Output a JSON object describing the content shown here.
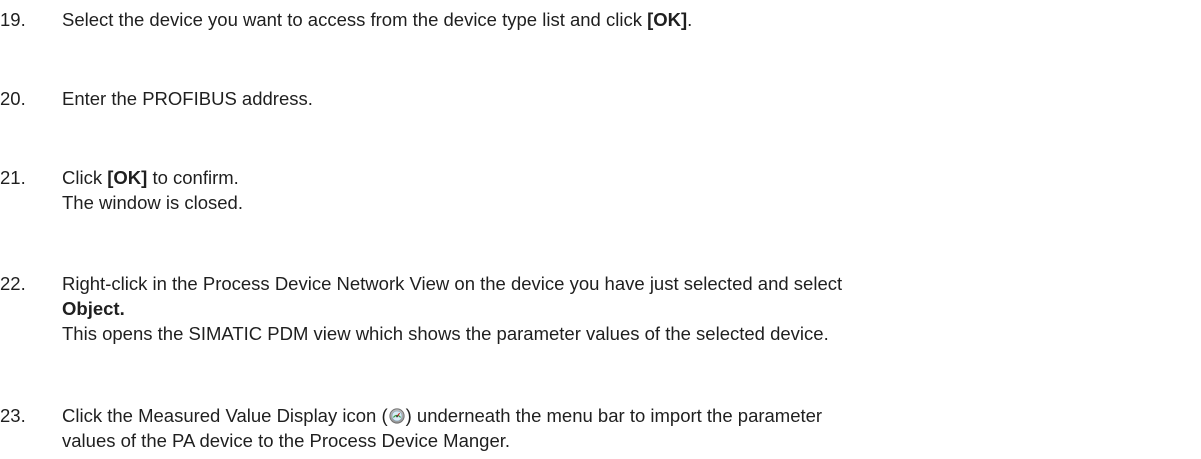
{
  "steps": [
    {
      "number": "19.",
      "line1_pre": "Select the device you want to access from the device type list and click ",
      "line1_bold": "[OK]",
      "line1_post": "."
    },
    {
      "number": "20.",
      "line1": "Enter the PROFIBUS address."
    },
    {
      "number": "21.",
      "line1_pre": "Click ",
      "line1_bold": "[OK]",
      "line1_post": " to confirm.",
      "line2": "The window is closed."
    },
    {
      "number": "22.",
      "line1": "Right-click in the Process Device Network View on the device you have just selected and select",
      "line2_bold": "Object.",
      "line3": "This opens the SIMATIC PDM view which shows the parameter values of the selected device."
    },
    {
      "number": "23.",
      "line1_pre": "Click the Measured Value Display icon (",
      "line1_icon": "measured-value-display-icon",
      "line1_post": ") underneath the menu bar to import the parameter",
      "line2": "values of the PA device to the Process Device Manger."
    }
  ]
}
